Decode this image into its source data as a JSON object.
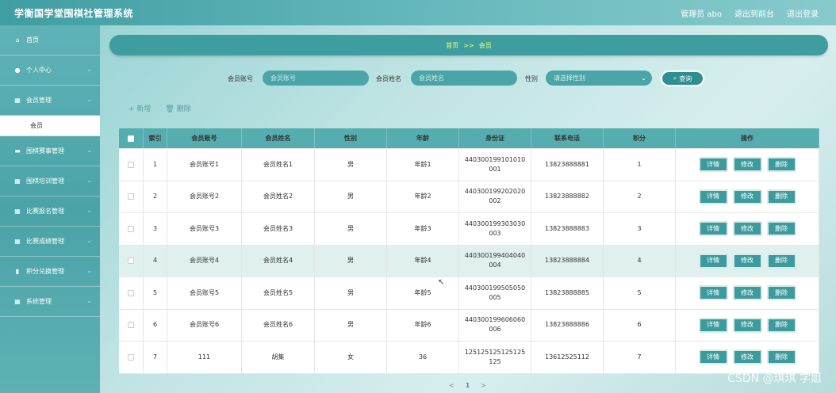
{
  "header": {
    "title": "学衡国学堂围棋社管理系统",
    "user": "管理员 abo",
    "exit_front": "退出到前台",
    "logout": "退出登录"
  },
  "sidebar": {
    "items": [
      {
        "label": "首页",
        "icon": "home-icon",
        "glyph": "⌂",
        "chev": false
      },
      {
        "label": "个人中心",
        "icon": "user-icon",
        "glyph": "●",
        "chev": true
      },
      {
        "label": "会员管理",
        "icon": "grid-icon",
        "glyph": "▦",
        "chev": true
      },
      {
        "label": "围棋赛事管理",
        "icon": "monitor-icon",
        "glyph": "▬",
        "chev": true
      },
      {
        "label": "围棋培训管理",
        "icon": "grid-icon",
        "glyph": "▦",
        "chev": true
      },
      {
        "label": "比赛报名管理",
        "icon": "grid-icon",
        "glyph": "▦",
        "chev": true
      },
      {
        "label": "比赛成绩管理",
        "icon": "grid-icon",
        "glyph": "▦",
        "chev": true
      },
      {
        "label": "积分兑换管理",
        "icon": "bar-chart-icon",
        "glyph": "▮",
        "chev": true
      },
      {
        "label": "系统管理",
        "icon": "grid-icon",
        "glyph": "▦",
        "chev": true
      }
    ],
    "submenu": "会员"
  },
  "breadcrumb": {
    "home": "首页",
    "sep": ">>",
    "current": "会员"
  },
  "search": {
    "account_label": "会员账号",
    "account_placeholder": "会员账号",
    "name_label": "会员姓名",
    "name_placeholder": "会员姓名",
    "gender_label": "性别",
    "gender_placeholder": "请选择性别",
    "query": "查询"
  },
  "actions": {
    "add": "+ 新增",
    "delete": "🗑 删除"
  },
  "table": {
    "headers": [
      "索引",
      "会员账号",
      "会员姓名",
      "性别",
      "年龄",
      "身份证",
      "联系电话",
      "积分",
      "操作"
    ],
    "buttons": {
      "detail": "详情",
      "edit": "修改",
      "delete": "删除"
    },
    "rows": [
      {
        "idx": "1",
        "account": "会员账号1",
        "name": "会员姓名1",
        "gender": "男",
        "age": "年龄1",
        "id_card": "440300199101010001",
        "phone": "13823888881",
        "points": "1"
      },
      {
        "idx": "2",
        "account": "会员账号2",
        "name": "会员姓名2",
        "gender": "男",
        "age": "年龄2",
        "id_card": "440300199202020002",
        "phone": "13823888882",
        "points": "2"
      },
      {
        "idx": "3",
        "account": "会员账号3",
        "name": "会员姓名3",
        "gender": "男",
        "age": "年龄3",
        "id_card": "440300199303030003",
        "phone": "13823888883",
        "points": "3"
      },
      {
        "idx": "4",
        "account": "会员账号4",
        "name": "会员姓名4",
        "gender": "男",
        "age": "年龄4",
        "id_card": "440300199404040004",
        "phone": "13823888884",
        "points": "4"
      },
      {
        "idx": "5",
        "account": "会员账号5",
        "name": "会员姓名5",
        "gender": "男",
        "age": "年龄5",
        "id_card": "440300199505050005",
        "phone": "13823888885",
        "points": "5"
      },
      {
        "idx": "6",
        "account": "会员账号6",
        "name": "会员姓名6",
        "gender": "男",
        "age": "年龄6",
        "id_card": "440300199606060006",
        "phone": "13823888886",
        "points": "6"
      },
      {
        "idx": "7",
        "account": "111",
        "name": "胡集",
        "gender": "女",
        "age": "36",
        "id_card": "125125125125125125",
        "phone": "13612525112",
        "points": "7"
      }
    ]
  },
  "pager": {
    "prev": "<",
    "page": "1",
    "next": ">"
  },
  "watermark": "CSDN @琪琪 学姐"
}
